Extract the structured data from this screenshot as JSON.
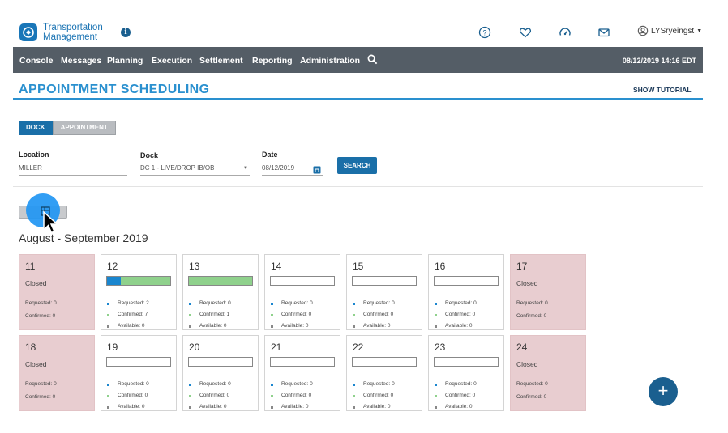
{
  "header": {
    "app_name_line1": "Transportation",
    "app_name_line2": "Management",
    "info_icon": "info-icon",
    "icons": [
      "help-icon",
      "favorites-heart-icon",
      "dashboard-gauge-icon",
      "mail-icon"
    ],
    "user": "LYSryeingst",
    "user_icon": "user-circle-icon"
  },
  "nav": {
    "items": [
      "Console",
      "Messages",
      "Planning",
      "Execution",
      "Settlement",
      "Reporting",
      "Administration"
    ],
    "search_icon": "search-icon",
    "datetime": "08/12/2019 14:16 EDT"
  },
  "page": {
    "title": "APPOINTMENT SCHEDULING",
    "tutorial": "SHOW TUTORIAL",
    "accent": "#2a90cf"
  },
  "toggle": {
    "dock": "DOCK",
    "appointment": "APPOINTMENT",
    "active": "DOCK"
  },
  "filters": {
    "location_label": "Location",
    "location_value": "MILLER",
    "dock_label": "Dock",
    "dock_value": "DC 1 - LIVE/DROP IB/OB",
    "date_label": "Date",
    "date_value": "08/12/2019",
    "search": "SEARCH"
  },
  "calendar": {
    "range": "August - September 2019",
    "closed_label": "Closed",
    "req_label": "Requested:",
    "conf_label": "Confirmed:",
    "avail_label": "Available:",
    "days": [
      {
        "day": "11",
        "closed": true,
        "requested": "0",
        "confirmed": "0"
      },
      {
        "day": "12",
        "closed": false,
        "requested": "2",
        "confirmed": "7",
        "available": "0",
        "req_frac": 0.22,
        "conf_frac": 0.78
      },
      {
        "day": "13",
        "closed": false,
        "requested": "0",
        "confirmed": "1",
        "available": "0",
        "req_frac": 0,
        "conf_frac": 1
      },
      {
        "day": "14",
        "closed": false,
        "requested": "0",
        "confirmed": "0",
        "available": "0",
        "req_frac": 0,
        "conf_frac": 0
      },
      {
        "day": "15",
        "closed": false,
        "requested": "0",
        "confirmed": "0",
        "available": "0",
        "req_frac": 0,
        "conf_frac": 0
      },
      {
        "day": "16",
        "closed": false,
        "requested": "0",
        "confirmed": "0",
        "available": "0",
        "req_frac": 0,
        "conf_frac": 0
      },
      {
        "day": "17",
        "closed": true,
        "requested": "0",
        "confirmed": "0"
      },
      {
        "day": "18",
        "closed": true,
        "requested": "0",
        "confirmed": "0"
      },
      {
        "day": "19",
        "closed": false,
        "requested": "0",
        "confirmed": "0",
        "available": "0",
        "req_frac": 0,
        "conf_frac": 0
      },
      {
        "day": "20",
        "closed": false,
        "requested": "0",
        "confirmed": "0",
        "available": "0",
        "req_frac": 0,
        "conf_frac": 0
      },
      {
        "day": "21",
        "closed": false,
        "requested": "0",
        "confirmed": "0",
        "available": "0",
        "req_frac": 0,
        "conf_frac": 0
      },
      {
        "day": "22",
        "closed": false,
        "requested": "0",
        "confirmed": "0",
        "available": "0",
        "req_frac": 0,
        "conf_frac": 0
      },
      {
        "day": "23",
        "closed": false,
        "requested": "0",
        "confirmed": "0",
        "available": "0",
        "req_frac": 0,
        "conf_frac": 0
      },
      {
        "day": "24",
        "closed": true,
        "requested": "0",
        "confirmed": "0"
      }
    ],
    "colors": {
      "requested": "#1a86cf",
      "confirmed": "#8fd18c",
      "available": "#888888",
      "closed_bg": "#e8cdd0"
    }
  },
  "fab": {
    "add": "+"
  }
}
